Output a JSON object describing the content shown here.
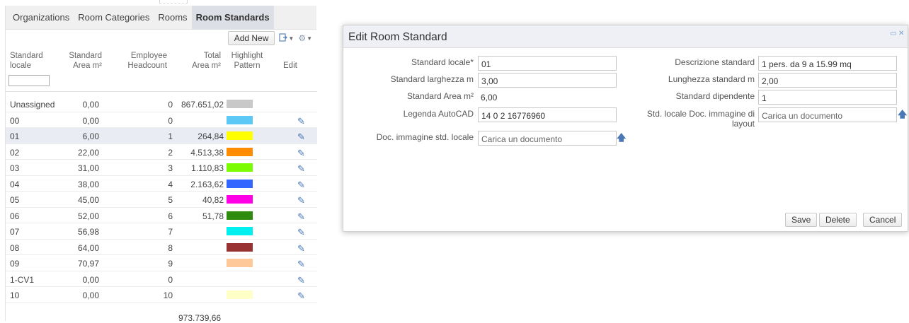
{
  "tabs": [
    {
      "label": "Organizations"
    },
    {
      "label": "Room Categories"
    },
    {
      "label": "Rooms"
    },
    {
      "label": "Room Standards"
    }
  ],
  "toolbar": {
    "add_new_label": "Add New",
    "export_icon": "export-icon",
    "settings_icon": "gear-icon"
  },
  "grid": {
    "headers": {
      "col1": "Standard\nlocale",
      "col2": "Standard\nArea m²",
      "col3": "Employee\nHeadcount",
      "col4": "Total\nArea m²",
      "col5": "Highlight\nPattern",
      "col6": "Edit"
    },
    "rows": [
      {
        "code": "Unassigned",
        "area": "0,00",
        "headcount": "0",
        "total": "867.651,02",
        "color": "#c8c8c8",
        "editable": false
      },
      {
        "code": "00",
        "area": "0,00",
        "headcount": "0",
        "total": "",
        "color": "#5bc8f5",
        "editable": true
      },
      {
        "code": "01",
        "area": "6,00",
        "headcount": "1",
        "total": "264,84",
        "color": "#ffff00",
        "editable": true
      },
      {
        "code": "02",
        "area": "22,00",
        "headcount": "2",
        "total": "4.513,38",
        "color": "#ff8c00",
        "editable": true
      },
      {
        "code": "03",
        "area": "31,00",
        "headcount": "3",
        "total": "1.110,83",
        "color": "#7cfc00",
        "editable": true
      },
      {
        "code": "04",
        "area": "38,00",
        "headcount": "4",
        "total": "2.163,62",
        "color": "#3366ff",
        "editable": true
      },
      {
        "code": "05",
        "area": "45,00",
        "headcount": "5",
        "total": "40,82",
        "color": "#ff00e6",
        "editable": true
      },
      {
        "code": "06",
        "area": "52,00",
        "headcount": "6",
        "total": "51,78",
        "color": "#2e8b0e",
        "editable": true
      },
      {
        "code": "07",
        "area": "56,98",
        "headcount": "7",
        "total": "",
        "color": "#00f0f0",
        "editable": true
      },
      {
        "code": "08",
        "area": "64,00",
        "headcount": "8",
        "total": "",
        "color": "#993333",
        "editable": true
      },
      {
        "code": "09",
        "area": "70,97",
        "headcount": "9",
        "total": "",
        "color": "#ffc899",
        "editable": true
      },
      {
        "code": "1-CV1",
        "area": "0,00",
        "headcount": "0",
        "total": "",
        "color": "",
        "editable": true
      },
      {
        "code": "10",
        "area": "0,00",
        "headcount": "10",
        "total": "",
        "color": "#ffffc8",
        "editable": true
      }
    ],
    "grand_total": "973.739,66"
  },
  "dialog": {
    "title": "Edit Room Standard",
    "left_fields": {
      "standard_locale_label": "Standard locale*",
      "standard_locale_value": "01",
      "larghezza_label": "Standard larghezza m",
      "larghezza_value": "3,00",
      "area_label": "Standard Area m²",
      "area_value": "6,00",
      "autocad_label": "Legenda AutoCAD",
      "autocad_value": "14 0 2 16776960",
      "doc_img_label": "Doc. immagine std. locale",
      "doc_img_placeholder": "Carica un documento"
    },
    "right_fields": {
      "descrizione_label": "Descrizione standard",
      "descrizione_value": "1 pers. da 9 a 15.99 mq",
      "lunghezza_label": "Lunghezza standard m",
      "lunghezza_value": "2,00",
      "dipendente_label": "Standard dipendente",
      "dipendente_value": "1",
      "layout_doc_label_1": "Std. locale Doc. immagine di",
      "layout_doc_label_2": "layout",
      "layout_doc_placeholder": "Carica un documento"
    },
    "buttons": {
      "save": "Save",
      "delete": "Delete",
      "cancel": "Cancel"
    }
  }
}
